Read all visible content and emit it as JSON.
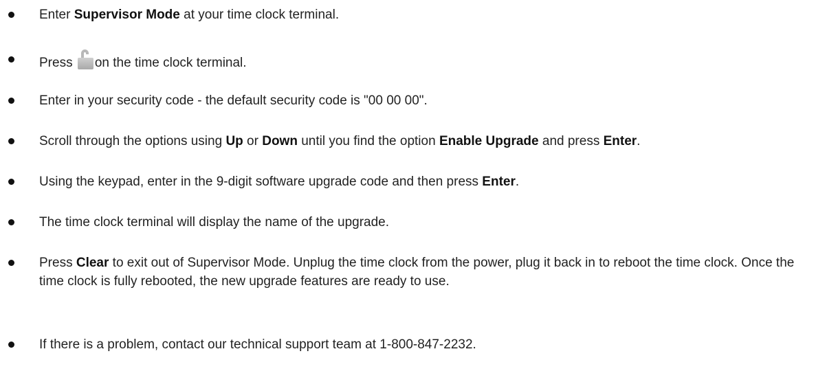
{
  "steps": [
    {
      "a": "Enter ",
      "b": "Supervisor Mode",
      "c": " at your time clock terminal."
    },
    {
      "a": "Press ",
      "icon": "lock-icon",
      "c": "on the time clock terminal."
    },
    {
      "a": "Enter in your security code - the default security code is \"00 00 00\"."
    },
    {
      "a": "Scroll through the options using ",
      "b": "Up",
      "c": " or ",
      "d": "Down",
      "e": " until you find the option ",
      "f": "Enable Upgrade",
      "g": " and press ",
      "h": "Enter",
      "i": "."
    },
    {
      "a": "Using the keypad, enter in the 9-digit software upgrade code and then press ",
      "b": "Enter",
      "c": "."
    },
    {
      "a": "The time clock terminal will display the name of the upgrade."
    },
    {
      "a": "Press ",
      "b": "Clear",
      "c": " to exit out of Supervisor Mode.  Unplug the time clock from the power, plug it back in to reboot the time clock. Once the time clock is fully rebooted, the new upgrade features are ready to use."
    },
    {
      "a": "If there is a problem, contact our technical support team at 1-800-847-2232."
    }
  ]
}
